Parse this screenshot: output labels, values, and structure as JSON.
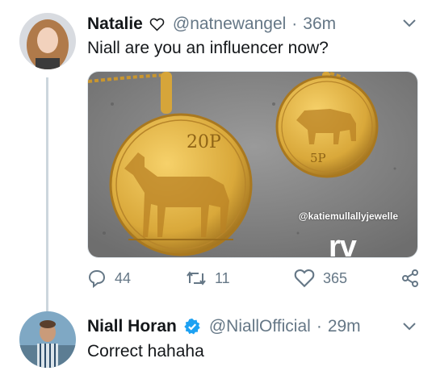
{
  "tweet1": {
    "name": "Natalie",
    "handle": "@natnewangel",
    "separator": "·",
    "time": "36m",
    "text": "Niall are you an influencer now?",
    "media": {
      "coin_large_label": "20P",
      "coin_small_label": "5P",
      "credit": "@katiemullallyjewelle",
      "watermark": "rv"
    },
    "actions": {
      "replies": "44",
      "retweets": "11",
      "likes": "365"
    }
  },
  "tweet2": {
    "name": "Niall Horan",
    "handle": "@NiallOfficial",
    "separator": "·",
    "time": "29m",
    "text": "Correct hahaha"
  },
  "colors": {
    "accent": "#1da1f2",
    "muted": "#657786",
    "gold": "#d9a83a",
    "verified": "#1da1f2"
  }
}
